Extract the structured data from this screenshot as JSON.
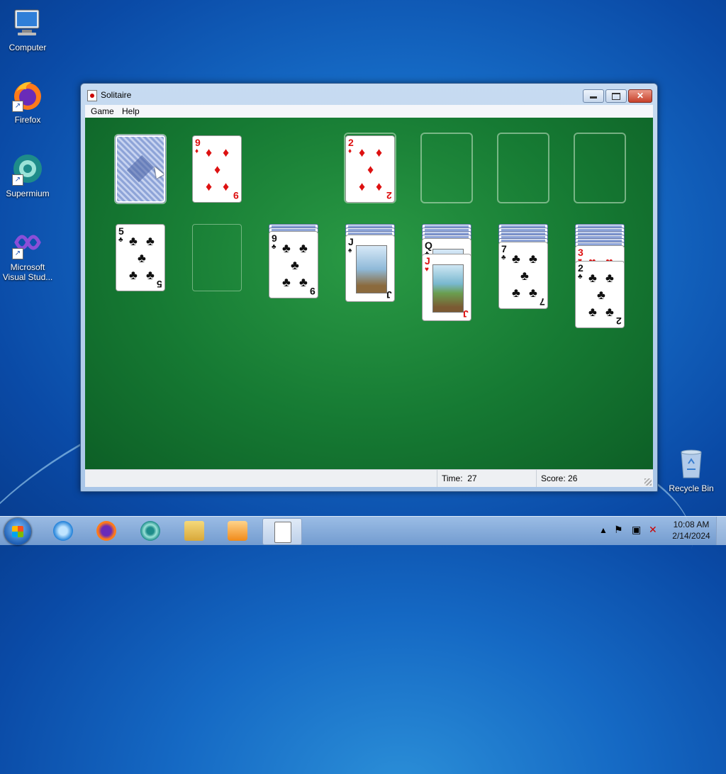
{
  "desktop": {
    "icons": [
      {
        "label": "Computer",
        "icon": "computer-icon"
      },
      {
        "label": "Firefox",
        "icon": "firefox-icon"
      },
      {
        "label": "Supermium",
        "icon": "supermium-icon"
      },
      {
        "label": "Microsoft Visual Stud...",
        "icon": "visual-studio-icon"
      },
      {
        "label": "Recycle Bin",
        "icon": "recycle-bin-icon"
      }
    ]
  },
  "window": {
    "title": "Solitaire",
    "menu": [
      "Game",
      "Help"
    ],
    "status": {
      "time_label": "Time:",
      "time_value": "27",
      "score_label": "Score:",
      "score_value": "26"
    }
  },
  "game": {
    "stock": {
      "face_down": true
    },
    "waste": {
      "rank": "9",
      "suit": "diamonds"
    },
    "foundations": [
      {
        "rank": "2",
        "suit": "diamonds"
      },
      {
        "rank": "",
        "suit": ""
      },
      {
        "rank": "",
        "suit": ""
      },
      {
        "rank": "",
        "suit": ""
      }
    ],
    "tableau": [
      {
        "hidden": 0,
        "up": [
          {
            "rank": "5",
            "suit": "clubs"
          }
        ]
      },
      {
        "hidden": 0,
        "up": []
      },
      {
        "hidden": 2,
        "up": [
          {
            "rank": "9",
            "suit": "clubs"
          }
        ]
      },
      {
        "hidden": 3,
        "up": [
          {
            "rank": "J",
            "suit": "spades"
          }
        ]
      },
      {
        "hidden": 4,
        "up": [
          {
            "rank": "Q",
            "suit": "clubs"
          },
          {
            "rank": "J",
            "suit": "hearts"
          }
        ]
      },
      {
        "hidden": 5,
        "up": [
          {
            "rank": "7",
            "suit": "clubs"
          }
        ]
      },
      {
        "hidden": 6,
        "up": [
          {
            "rank": "3",
            "suit": "hearts"
          },
          {
            "rank": "2",
            "suit": "clubs"
          }
        ]
      }
    ]
  },
  "taskbar": {
    "apps": [
      "internet-explorer-icon",
      "firefox-icon",
      "supermium-icon",
      "file-explorer-icon",
      "media-player-icon",
      "solitaire-icon"
    ],
    "clock_time": "10:08 AM",
    "clock_date": "2/14/2024"
  },
  "colors": {
    "felt": "#167a33",
    "red_suit": "#d11111",
    "black_suit": "#111111"
  }
}
